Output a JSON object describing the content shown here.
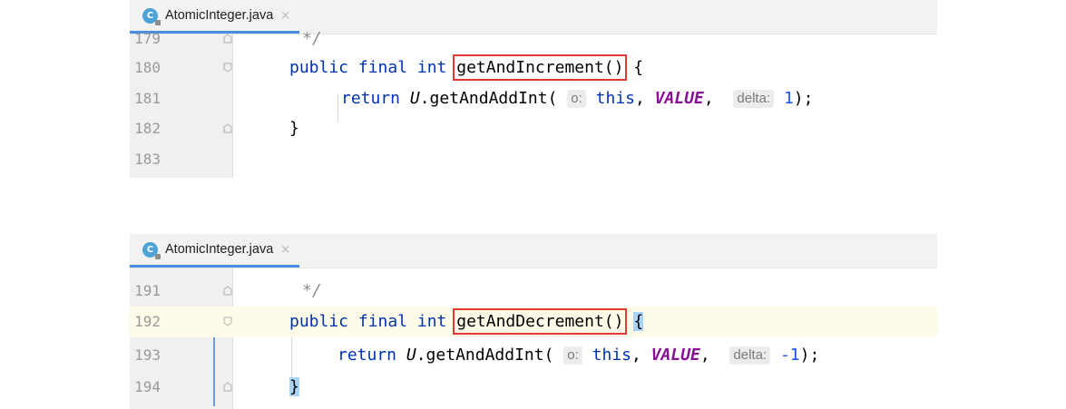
{
  "top_editor": {
    "tab": {
      "icon_letter": "C",
      "filename": "AtomicInteger.java",
      "close": "×"
    },
    "lines": [
      {
        "num": "179",
        "code": "*/"
      },
      {
        "num": "180",
        "kw": "public final int",
        "method": "getAndIncrement()",
        "tail": " {"
      },
      {
        "num": "181",
        "ret": "return",
        "obj": "U",
        "call": ".getAndAddInt(",
        "hint1": "o:",
        "this": "this",
        "sep": ",",
        "const": "VALUE",
        "sep2": ",",
        "hint2": "delta:",
        "arg": "1",
        "end": ");"
      },
      {
        "num": "182",
        "code": "}"
      },
      {
        "num": "183",
        "code": ""
      }
    ]
  },
  "bottom_editor": {
    "tab": {
      "icon_letter": "C",
      "filename": "AtomicInteger.java",
      "close": "×"
    },
    "lines": [
      {
        "num": "191",
        "code": "*/"
      },
      {
        "num": "192",
        "kw": "public final int",
        "method": "getAndDecrement()",
        "tail": "{"
      },
      {
        "num": "193",
        "ret": "return",
        "obj": "U",
        "call": ".getAndAddInt(",
        "hint1": "o:",
        "this": "this",
        "sep": ",",
        "const": "VALUE",
        "sep2": ",",
        "hint2": "delta:",
        "arg": "-1",
        "end": ");"
      },
      {
        "num": "194",
        "code": "}"
      }
    ]
  },
  "colors": {
    "keyword": "#0033b3",
    "constant": "#871094",
    "number": "#1750eb",
    "highlight_box": "#e53935",
    "brace_match": "#a9d3f7",
    "current_line": "#fefbe9",
    "tab_underline": "#4a8de0"
  }
}
